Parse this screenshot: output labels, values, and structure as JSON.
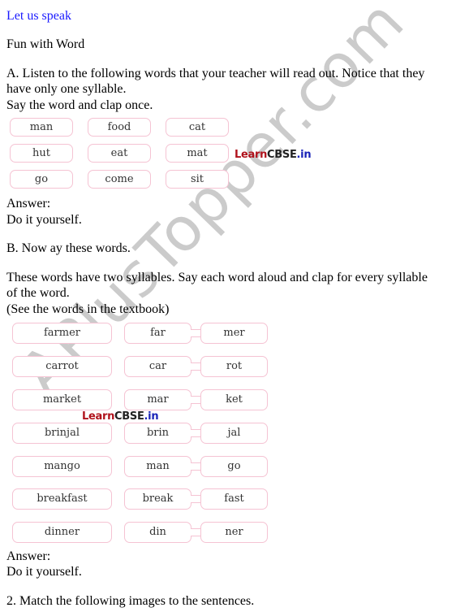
{
  "heading": "Let us speak",
  "subheading": "Fun with Word",
  "section_a": {
    "line1": "A. Listen to the following words that your teacher will read out. Notice that they",
    "line2": "have only one syllable.",
    "line3": "Say the word and clap once.",
    "words": [
      "man",
      "food",
      "cat",
      "hut",
      "eat",
      "mat",
      "go",
      "come",
      "sit"
    ],
    "answer_label": "Answer:",
    "answer": "Do it yourself."
  },
  "section_b": {
    "title": "B. Now ay these words.",
    "line1": "These words have two syllables. Say each word aloud and clap for every syllable",
    "line2": "of the word.",
    "line3": "(See the words in the textbook)",
    "rows": [
      {
        "word": "farmer",
        "s1": "far",
        "s2": "mer"
      },
      {
        "word": "carrot",
        "s1": "car",
        "s2": "rot"
      },
      {
        "word": "market",
        "s1": "mar",
        "s2": "ket"
      },
      {
        "word": "brinjal",
        "s1": "brin",
        "s2": "jal"
      },
      {
        "word": "mango",
        "s1": "man",
        "s2": "go"
      },
      {
        "word": "breakfast",
        "s1": "break",
        "s2": "fast"
      },
      {
        "word": "dinner",
        "s1": "din",
        "s2": "ner"
      }
    ],
    "answer_label": "Answer:",
    "answer": "Do it yourself."
  },
  "question2": "2. Match the following images to the sentences.",
  "logo": {
    "part1": "Learn",
    "part2": "CBSE",
    "part3": ".in"
  },
  "watermark": "APlusTopper.com"
}
